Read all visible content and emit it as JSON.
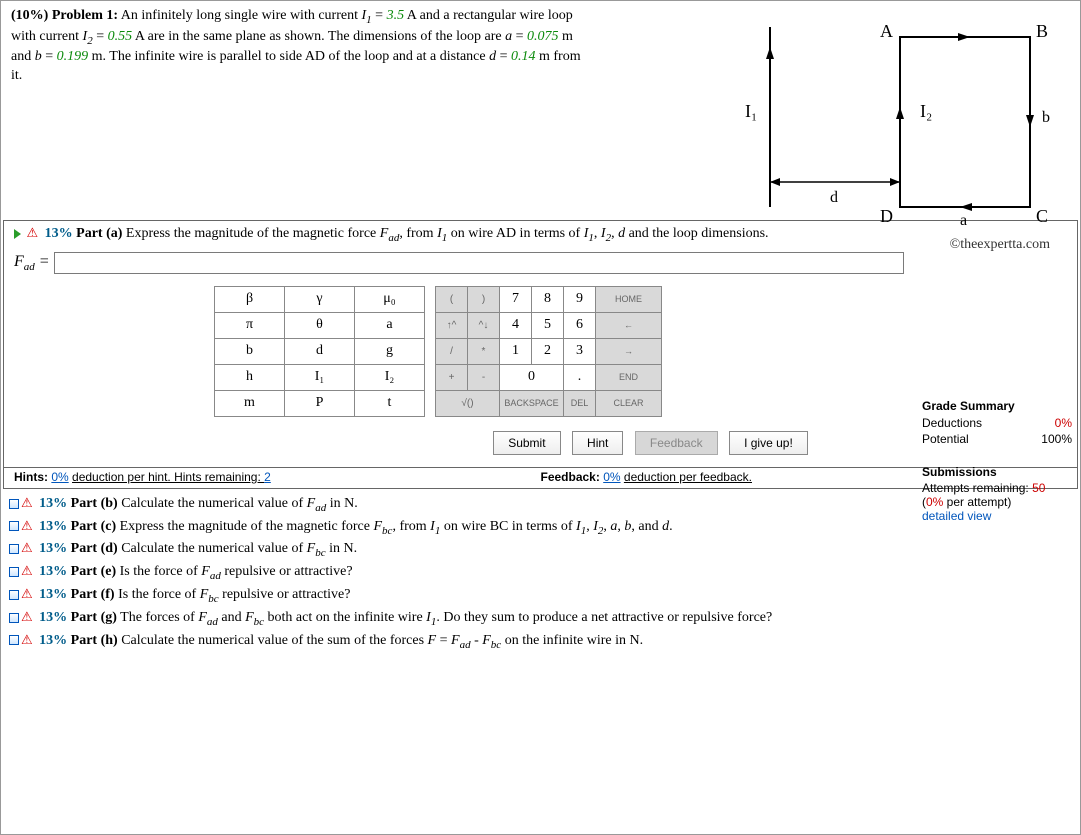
{
  "problem": {
    "header": "(10%) Problem 1:",
    "line1_a": "An infinitely long single wire with current ",
    "I1_label": "I",
    "I1_sub": "1",
    "I1_eq": " = ",
    "I1_val": "3.5",
    "line1_b": " A and a rectangular wire loop",
    "line2_a": "with current ",
    "I2_label": "I",
    "I2_sub": "2",
    "I2_eq": " = ",
    "I2_val": "0.55",
    "line2_b": " A are in the same plane as shown. The dimensions of the loop are ",
    "a_label": "a",
    "a_eq": " = ",
    "a_val": "0.075",
    "line2_c": " m",
    "line3_a": "and ",
    "b_label": "b",
    "b_eq": " = ",
    "b_val": "0.199",
    "line3_b": " m. The infinite wire is parallel to side AD of the loop and at a distance ",
    "d_label": "d",
    "d_eq": " = ",
    "d_val": "0.14",
    "line3_c": " m from",
    "line4": "it."
  },
  "copyright": "©theexpertta.com",
  "diagram": {
    "A": "A",
    "B": "B",
    "C": "C",
    "D": "D",
    "I1": "I₁",
    "I2": "I₂",
    "a": "a",
    "b": "b",
    "d": "d"
  },
  "partA": {
    "pct": "13%",
    "label": "Part (a)",
    "text_a": "Express the magnitude of the magnetic force ",
    "F_name": "F",
    "F_sub": "ad",
    "F_comma": ", ",
    "text_b": "from ",
    "I1": "I",
    "I1_sub": "1",
    "text_c": " on wire AD in terms of ",
    "I1b": "I",
    "I1b_sub": "1",
    "comma1": ", ",
    "I2": "I",
    "I2_sub": "2",
    "comma2": ", ",
    "dvar": "d",
    "text_d": " and the loop dimensions."
  },
  "answer_prefix": "F",
  "answer_sub": "ad",
  "answer_eq": " = ",
  "answer_value": "",
  "summary": {
    "title": "Grade Summary",
    "ded_label": "Deductions",
    "ded_val": "0%",
    "pot_label": "Potential",
    "pot_val": "100%",
    "sub_title": "Submissions",
    "attempts_a": "Attempts remaining:",
    "attempts_n": "50",
    "per_a": "(",
    "per_n": "0%",
    "per_b": " per attempt)",
    "detailed": "detailed view"
  },
  "symbols": [
    [
      "β",
      "γ",
      "μ₀"
    ],
    [
      "π",
      "θ",
      "a"
    ],
    [
      "b",
      "d",
      "g"
    ],
    [
      "h",
      "I₁",
      "I₂"
    ],
    [
      "m",
      "P",
      "t"
    ]
  ],
  "numpad": [
    [
      "(",
      ")",
      "7",
      "8",
      "9",
      "HOME"
    ],
    [
      "↑^",
      "^↓",
      "4",
      "5",
      "6",
      "←"
    ],
    [
      "/",
      "*",
      "1",
      "2",
      "3",
      "→"
    ],
    [
      "+",
      "-",
      "0",
      ".",
      "END"
    ],
    [
      "√()",
      "BACKSPACE",
      "DEL",
      "CLEAR"
    ]
  ],
  "buttons": {
    "submit": "Submit",
    "hint": "Hint",
    "feedback": "Feedback",
    "giveup": "I give up!"
  },
  "hints": {
    "label": "Hints:",
    "pct": "0%",
    "mid": " deduction per hint. Hints remaining: ",
    "remain": "2",
    "fb_label": "Feedback:",
    "fb_pct": "0%",
    "fb_mid": " deduction per feedback."
  },
  "sub_pct": "13%",
  "subparts": {
    "b": {
      "label": "Part (b)",
      "pre": "Calculate the numerical value of ",
      "F": "F",
      "Fsub": "ad",
      "post": " in N."
    },
    "c": {
      "label": "Part (c)",
      "pre": "Express the magnitude of the magnetic force ",
      "F": "F",
      "Fsub": "bc",
      "mid": ", from ",
      "I": "I",
      "Isub": "1",
      "mid2": " on wire BC in terms of ",
      "I1": "I",
      "I1s": "1",
      "c1": ", ",
      "I2": "I",
      "I2s": "2",
      "c2": ", ",
      "a": "a",
      "c3": ", ",
      "b": "b",
      "c4": ", and ",
      "d": "d",
      "post": "."
    },
    "d": {
      "label": "Part (d)",
      "pre": "Calculate the numerical value of ",
      "F": "F",
      "Fsub": "bc",
      "post": " in N."
    },
    "e": {
      "label": "Part (e)",
      "pre": "Is the force of ",
      "F": "F",
      "Fsub": "ad",
      "post": " repulsive or attractive?"
    },
    "f": {
      "label": "Part (f)",
      "pre": "Is the force of ",
      "F": "F",
      "Fsub": "bc",
      "post": " repulsive or attractive?"
    },
    "g": {
      "label": "Part (g)",
      "pre": "The forces of ",
      "F1": "F",
      "F1s": "ad",
      "and": " and ",
      "F2": "F",
      "F2s": "bc",
      "mid": " both act on the infinite wire ",
      "I": "I",
      "Is": "1",
      "post": ". Do they sum to produce a net attractive or repulsive force?"
    },
    "h": {
      "label": "Part (h)",
      "pre": "Calculate the numerical value of the sum of the forces ",
      "F": "F",
      "eq": " = ",
      "F1": "F",
      "F1s": "ad",
      "minus": " - ",
      "F2": "F",
      "F2s": "bc",
      "post": " on the infinite wire in N."
    }
  }
}
